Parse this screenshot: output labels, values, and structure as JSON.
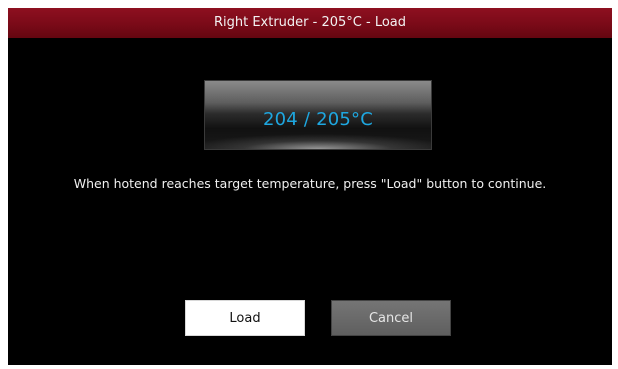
{
  "header": {
    "title": "Right Extruder - 205°C - Load"
  },
  "temperature": {
    "current": 204,
    "target": 205,
    "display": "204 / 205°C"
  },
  "instruction_text": "When hotend reaches target temperature, press \"Load\" button to continue.",
  "buttons": {
    "load_label": "Load",
    "cancel_label": "Cancel"
  },
  "colors": {
    "title_bar": "#7a0a18",
    "temperature_text": "#1ea7e0",
    "background": "#000000"
  }
}
